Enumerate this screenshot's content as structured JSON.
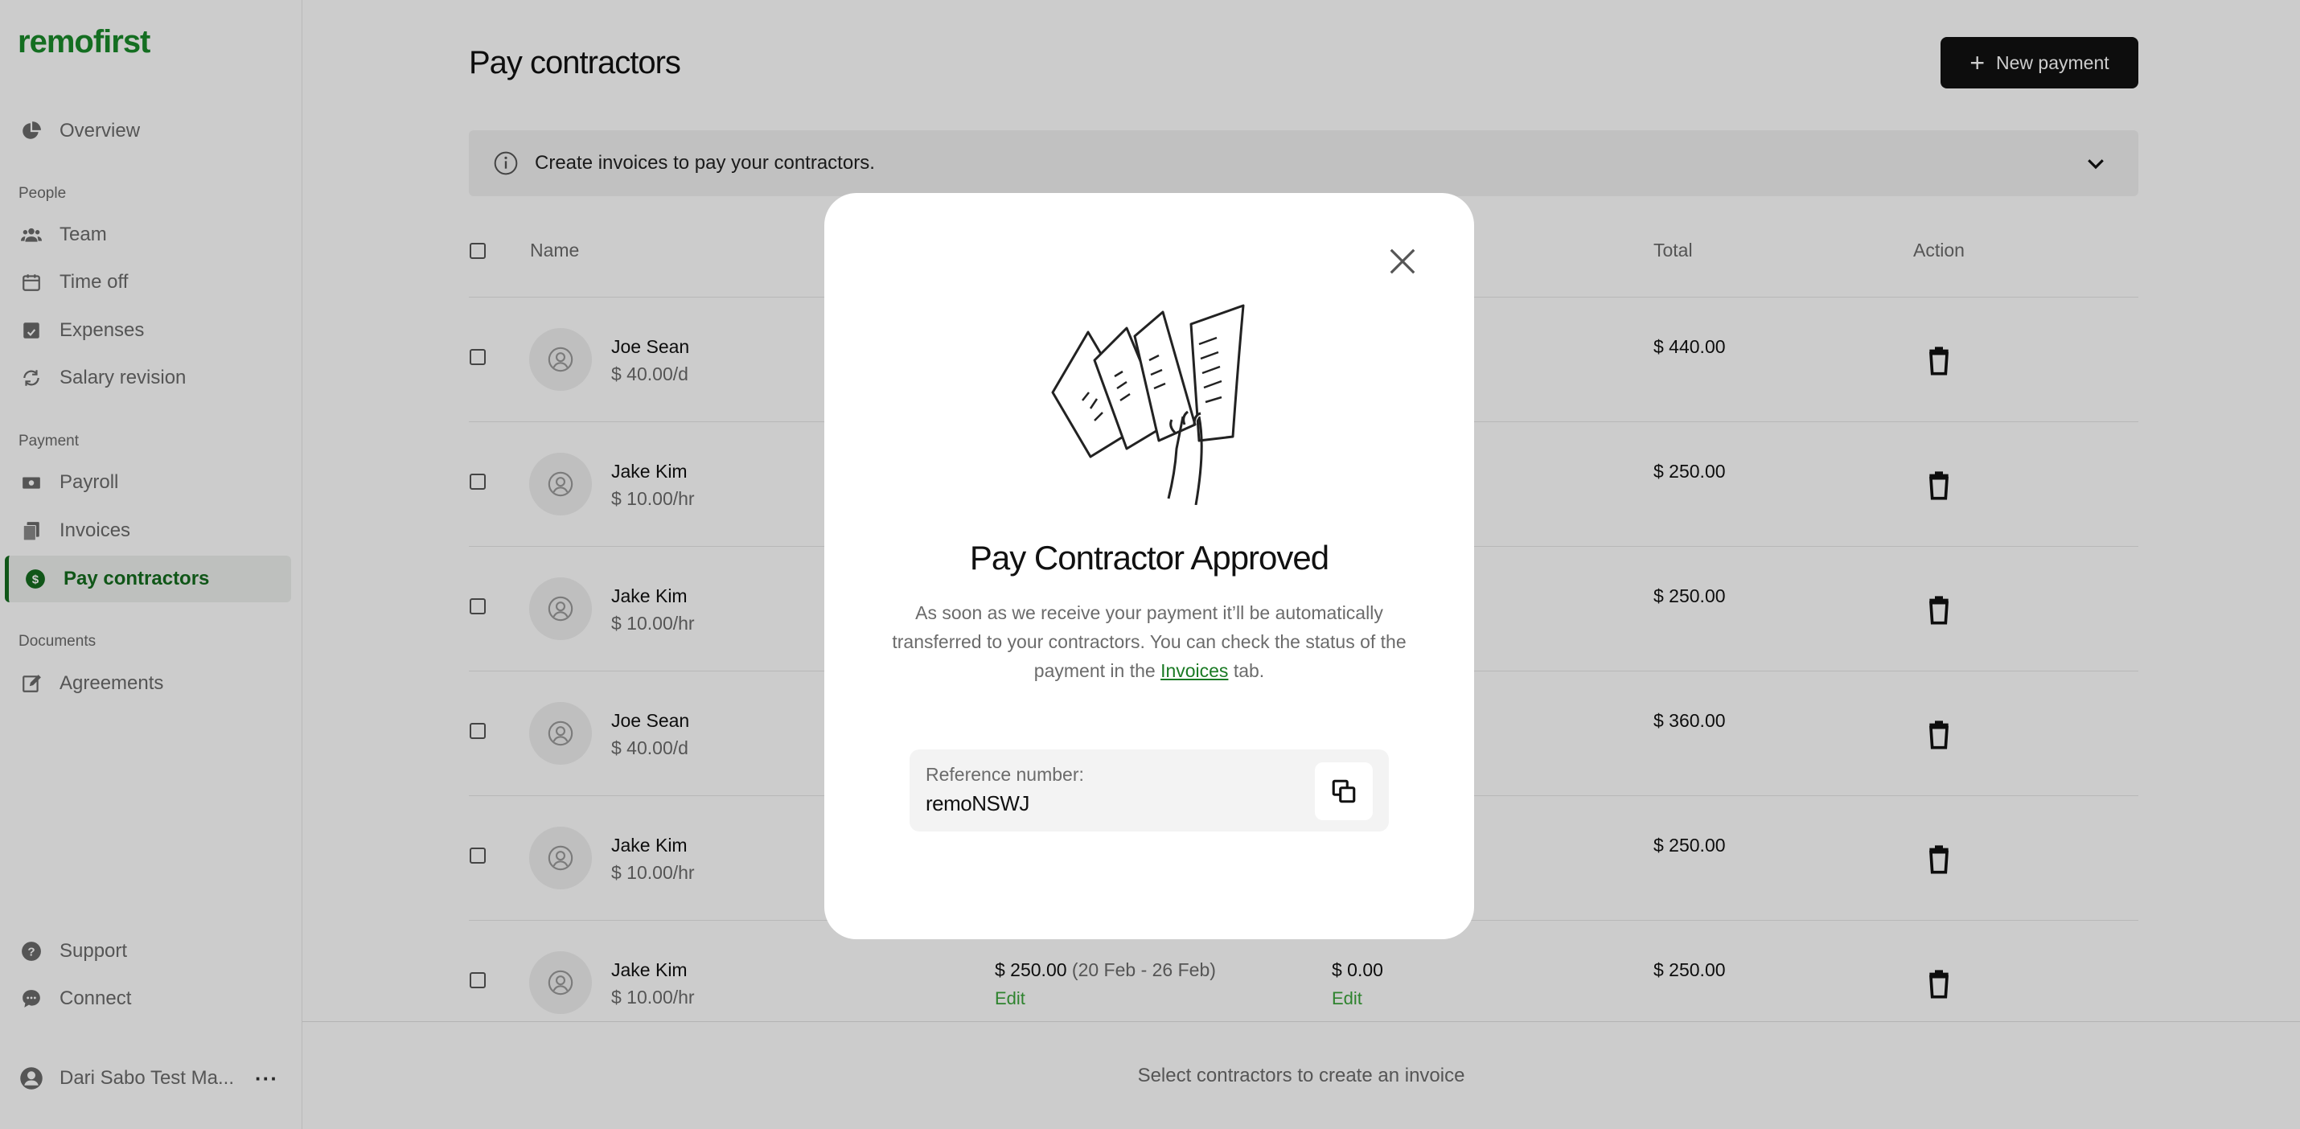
{
  "app": {
    "logo": "remofirst"
  },
  "sidebar": {
    "overview": "Overview",
    "section_people": "People",
    "team": "Team",
    "time_off": "Time off",
    "expenses": "Expenses",
    "salary_revision": "Salary revision",
    "section_payment": "Payment",
    "payroll": "Payroll",
    "invoices": "Invoices",
    "pay_contractors": "Pay contractors",
    "section_documents": "Documents",
    "agreements": "Agreements",
    "support": "Support",
    "connect": "Connect",
    "user_name": "Dari Sabo Test Ma...",
    "active_item": "Pay contractors"
  },
  "header": {
    "title": "Pay contractors",
    "new_payment_label": "New payment"
  },
  "banner": {
    "text": "Create invoices to pay your contractors."
  },
  "table": {
    "columns": {
      "name": "Name",
      "total": "Total",
      "action": "Action"
    },
    "rows": [
      {
        "name": "Joe Sean",
        "rate": "$ 40.00/d",
        "total": "$ 440.00"
      },
      {
        "name": "Jake Kim",
        "rate": "$ 10.00/hr",
        "total": "$ 250.00"
      },
      {
        "name": "Jake Kim",
        "rate": "$ 10.00/hr",
        "total": "$ 250.00"
      },
      {
        "name": "Joe Sean",
        "rate": "$ 40.00/d",
        "total": "$ 360.00"
      },
      {
        "name": "Jake Kim",
        "rate": "$ 10.00/hr",
        "total": "$ 250.00"
      },
      {
        "name": "Jake Kim",
        "rate": "$ 10.00/hr",
        "total": "$ 250.00",
        "amount": "$ 250.00",
        "period": "(20 Feb - 26 Feb)",
        "amount_edit": "Edit",
        "discount": "$ 0.00",
        "discount_edit": "Edit"
      }
    ]
  },
  "footer": {
    "text": "Select contractors to create an invoice"
  },
  "modal": {
    "title": "Pay Contractor Approved",
    "desc_before": "As soon as we receive your payment it’ll be automatically transferred to your contractors. You can check the status of the payment in the ",
    "desc_link": "Invoices",
    "desc_after": " tab.",
    "ref_label": "Reference number:",
    "ref_value": "remoNSWJ"
  },
  "colors": {
    "brand_green": "#1a8a2a",
    "active_green": "#146c1e",
    "link_green": "#3aa43a",
    "primary_button": "#111111"
  }
}
